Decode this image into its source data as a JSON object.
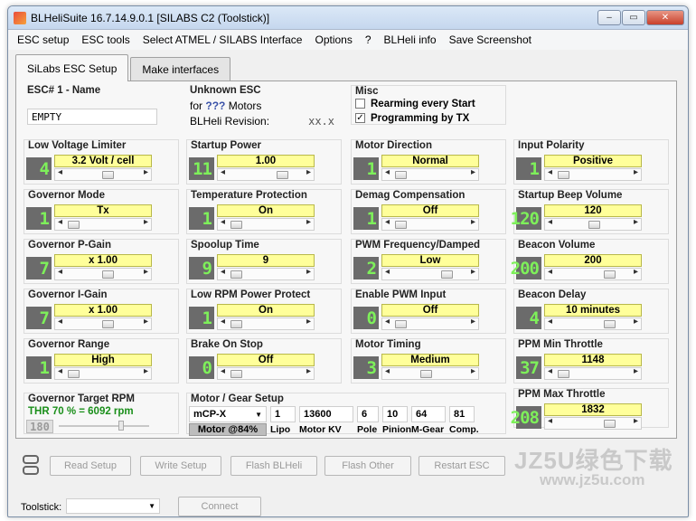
{
  "window": {
    "title": "BLHeliSuite 16.7.14.9.0.1  [SILABS C2 (Toolstick)]",
    "controls": [
      "‒",
      "▭",
      "✕"
    ]
  },
  "menu": [
    "ESC setup",
    "ESC tools",
    "Select ATMEL / SILABS Interface",
    "Options",
    "?",
    "BLHeli info",
    "Save Screenshot"
  ],
  "tabs": [
    {
      "label": "SiLabs ESC Setup",
      "active": true
    },
    {
      "label": "Make interfaces",
      "active": false
    }
  ],
  "esc": {
    "name_label": "ESC# 1 - Name",
    "name_value": "EMPTY",
    "unknown_label": "Unknown ESC",
    "for_text": "for",
    "motors_q": "???",
    "motors_text": "Motors",
    "revision_label": "BLHeli Revision:",
    "revision_value": "xx.x"
  },
  "misc": {
    "label": "Misc",
    "rearming": {
      "label": "Rearming every Start",
      "checked": false
    },
    "programming": {
      "label": "Programming by TX",
      "checked": true
    }
  },
  "settings": [
    {
      "label": "Low Voltage Limiter",
      "num": "4",
      "value": "3.2 Volt / cell",
      "thumb": 0.55
    },
    {
      "label": "Startup Power",
      "num": "11",
      "value": "1.00",
      "thumb": 0.72
    },
    {
      "label": "Motor Direction",
      "num": "1",
      "value": "Normal",
      "thumb": 0.05
    },
    {
      "label": "Input Polarity",
      "num": "1",
      "value": "Positive",
      "thumb": 0.05
    },
    {
      "label": "Governor Mode",
      "num": "1",
      "value": "Tx",
      "thumb": 0.05
    },
    {
      "label": "Temperature Protection",
      "num": "1",
      "value": "On",
      "thumb": 0.05
    },
    {
      "label": "Demag Compensation",
      "num": "1",
      "value": "Off",
      "thumb": 0.05
    },
    {
      "label": "Startup Beep Volume",
      "num": "120",
      "value": "120",
      "thumb": 0.5
    },
    {
      "label": "Governor P-Gain",
      "num": "7",
      "value": "x 1.00",
      "thumb": 0.55
    },
    {
      "label": "Spoolup Time",
      "num": "9",
      "value": "9",
      "thumb": 0.05
    },
    {
      "label": "PWM Frequency/Damped",
      "num": "2",
      "value": "Low",
      "thumb": 0.72
    },
    {
      "label": "Beacon Volume",
      "num": "200",
      "value": "200",
      "thumb": 0.72
    },
    {
      "label": "Governor I-Gain",
      "num": "7",
      "value": "x 1.00",
      "thumb": 0.55
    },
    {
      "label": "Low RPM Power Protect",
      "num": "1",
      "value": "On",
      "thumb": 0.05
    },
    {
      "label": "Enable PWM Input",
      "num": "0",
      "value": "Off",
      "thumb": 0.05
    },
    {
      "label": "Beacon Delay",
      "num": "4",
      "value": "10 minutes",
      "thumb": 0.72
    },
    {
      "label": "Governor Range",
      "num": "1",
      "value": "High",
      "thumb": 0.05
    },
    {
      "label": "Brake On Stop",
      "num": "0",
      "value": "Off",
      "thumb": 0.05
    },
    {
      "label": "Motor Timing",
      "num": "3",
      "value": "Medium",
      "thumb": 0.42
    },
    {
      "label": "PPM Min Throttle",
      "num": "37",
      "value": "1148",
      "thumb": 0.05
    },
    {
      "label": "PPM Max Throttle",
      "num": "208",
      "value": "1832",
      "thumb": 0.72
    }
  ],
  "governor_target": {
    "label": "Governor Target RPM",
    "readout": "THR 70 % = 6092 rpm",
    "num": "180"
  },
  "motor_gear": {
    "label": "Motor / Gear Setup",
    "model": "mCP-X",
    "motor_pct": "Motor @84%",
    "fields": [
      {
        "value": "1",
        "caption": "Lipo"
      },
      {
        "value": "13600",
        "caption": "Motor KV"
      },
      {
        "value": "6",
        "caption": "Pole"
      },
      {
        "value": "10",
        "caption": "Pinion"
      },
      {
        "value": "64",
        "caption": "M-Gear"
      },
      {
        "value": "81",
        "caption": "Comp."
      }
    ]
  },
  "actions": [
    "Read Setup",
    "Write Setup",
    "Flash BLHeli",
    "Flash Other",
    "Restart ESC"
  ],
  "toolstick": {
    "label": "Toolstick:",
    "connect": "Connect"
  },
  "watermark": {
    "brand": "JZ5U绿色下载",
    "url": "www.jz5u.com"
  },
  "colors": {
    "value_bg": "#ffff9a",
    "digit": "#7ef05a",
    "digit_bg": "#6b6b6b"
  }
}
